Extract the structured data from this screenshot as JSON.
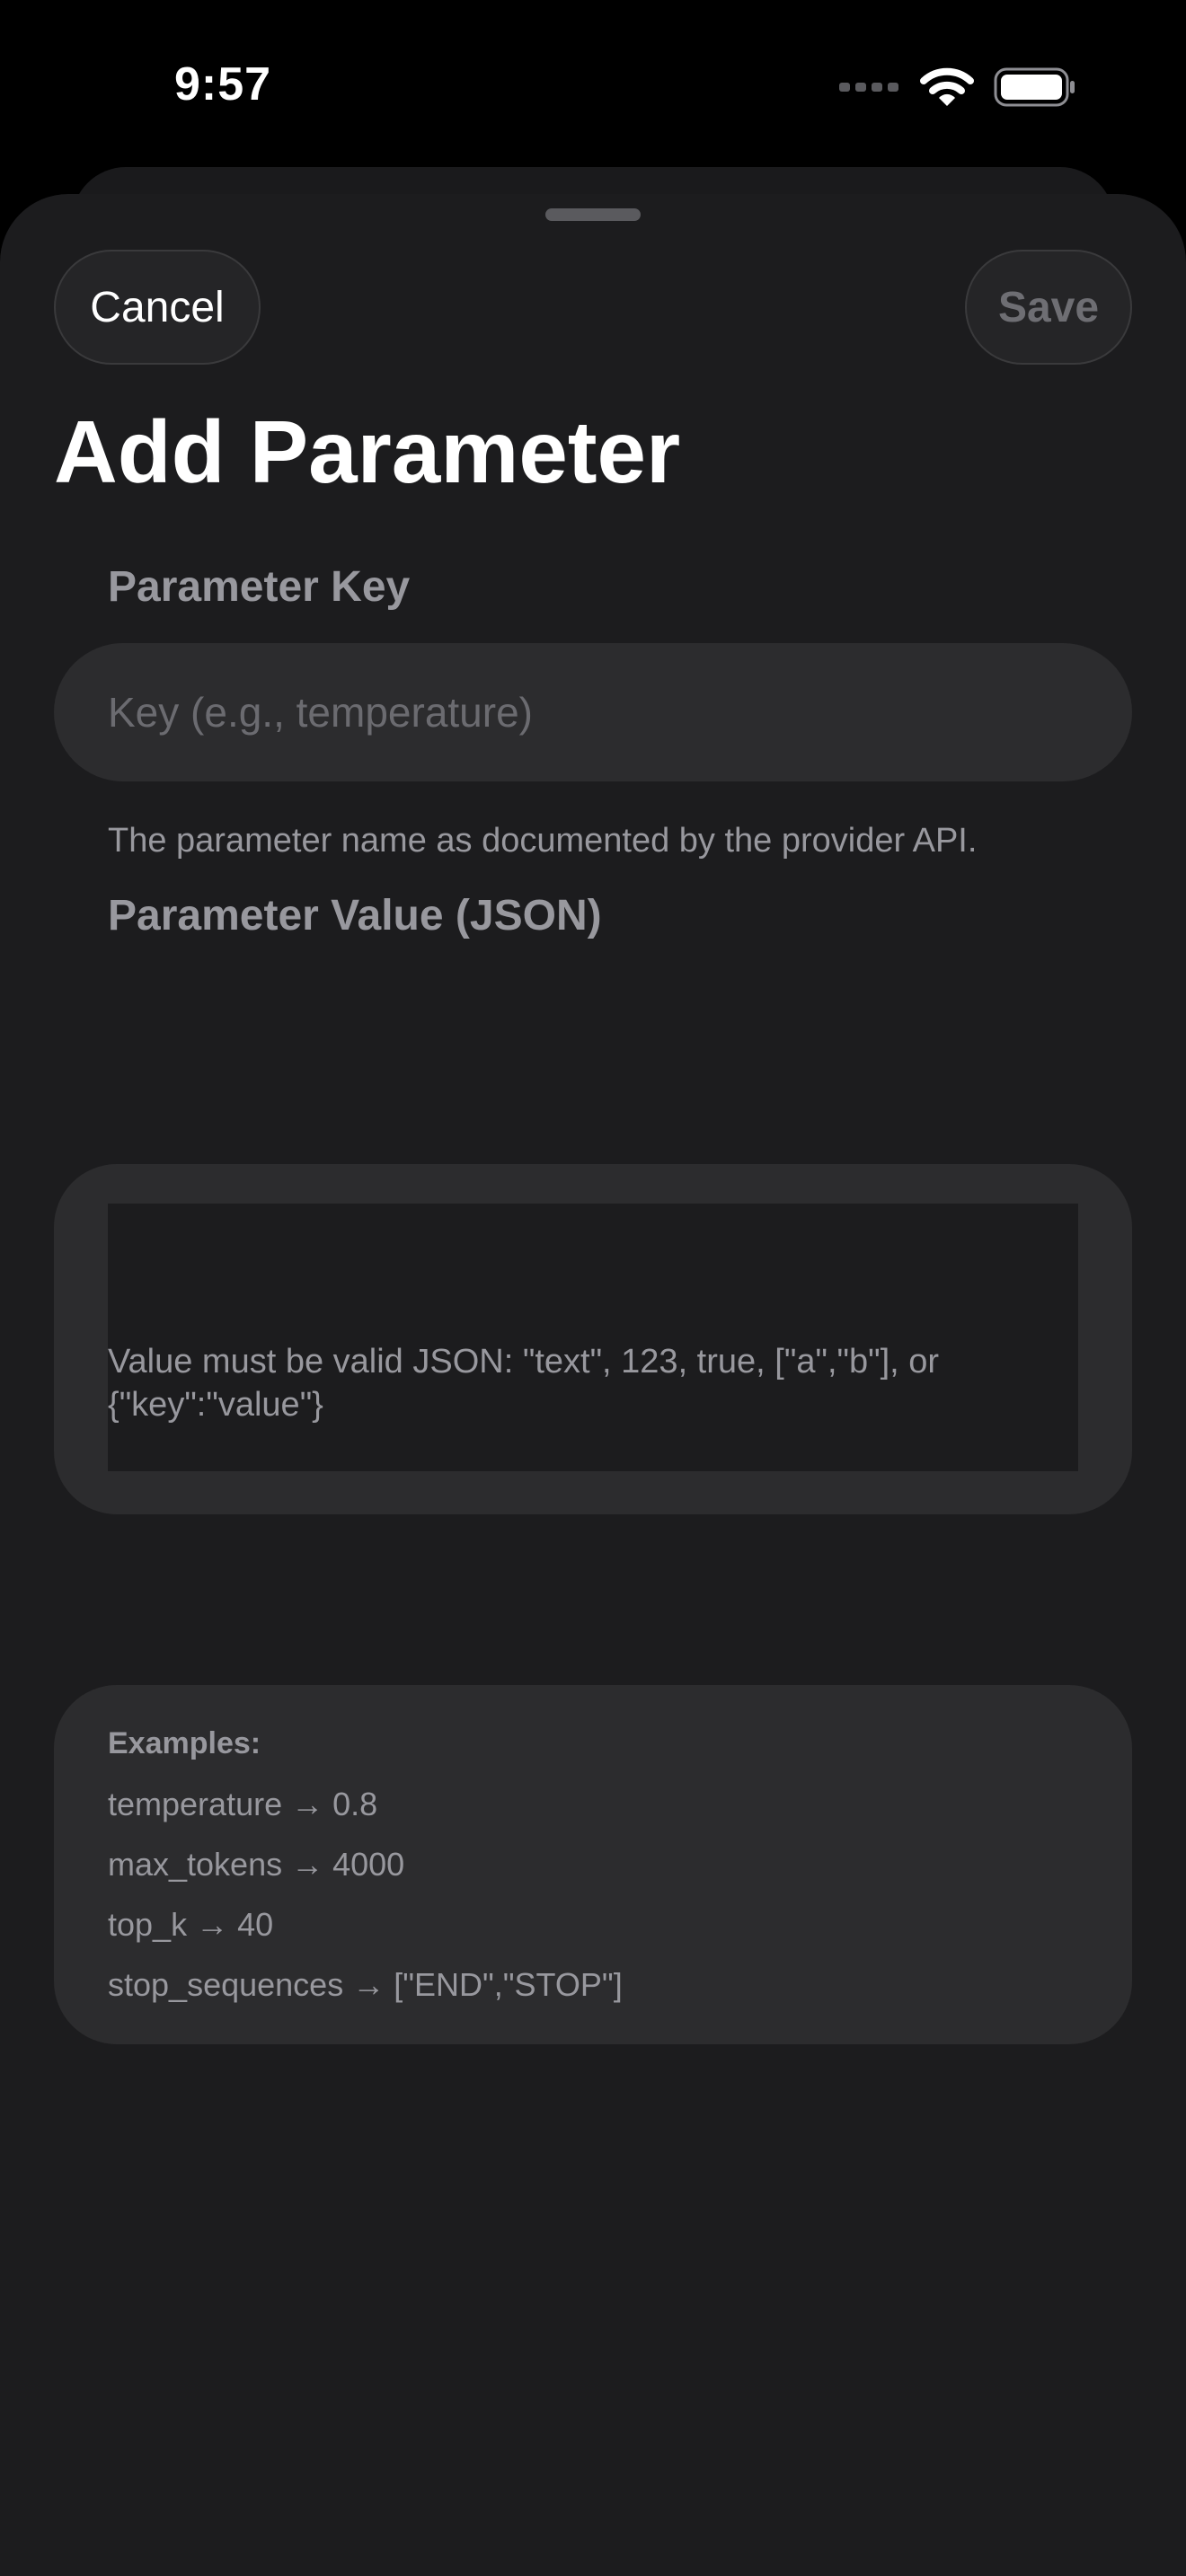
{
  "status_bar": {
    "time": "9:57",
    "icons": [
      "cellular-signal-icon",
      "wifi-icon",
      "battery-icon"
    ]
  },
  "toolbar": {
    "cancel_label": "Cancel",
    "save_label": "Save"
  },
  "title": "Add Parameter",
  "key_section": {
    "header": "Parameter Key",
    "placeholder": "Key (e.g., temperature)",
    "value": "",
    "footer": "The parameter name as documented by the provider API."
  },
  "value_section": {
    "header": "Parameter Value (JSON)",
    "value": "",
    "footer": "Value must be valid JSON: \"text\", 123, true, [\"a\",\"b\"], or {\"key\":\"value\"}"
  },
  "examples": {
    "title": "Examples:",
    "items": [
      "temperature → 0.8",
      "max_tokens → 4000",
      "top_k → 40",
      "stop_sequences → [\"END\",\"STOP\"]"
    ]
  },
  "colors": {
    "background": "#000000",
    "sheet": "#1c1c1e",
    "field": "#2c2c2e",
    "secondary_text": "#98989e",
    "placeholder_text": "#6b6b70"
  }
}
